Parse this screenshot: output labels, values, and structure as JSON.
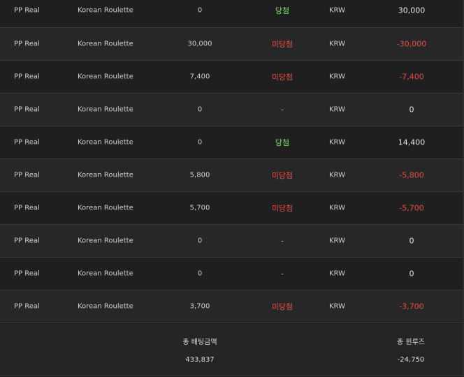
{
  "rows": [
    {
      "provider": "PP Real",
      "game": "Korean Roulette",
      "bet": "0",
      "result": "당첨",
      "result_type": "win",
      "currency": "KRW",
      "win": "30,000",
      "win_type": "pos"
    },
    {
      "provider": "PP Real",
      "game": "Korean Roulette",
      "bet": "30,000",
      "result": "미당첨",
      "result_type": "lose",
      "currency": "KRW",
      "win": "-30,000",
      "win_type": "neg"
    },
    {
      "provider": "PP Real",
      "game": "Korean Roulette",
      "bet": "7,400",
      "result": "미당첨",
      "result_type": "lose",
      "currency": "KRW",
      "win": "-7,400",
      "win_type": "neg"
    },
    {
      "provider": "PP Real",
      "game": "Korean Roulette",
      "bet": "0",
      "result": "-",
      "result_type": "none",
      "currency": "KRW",
      "win": "0",
      "win_type": "pos"
    },
    {
      "provider": "PP Real",
      "game": "Korean Roulette",
      "bet": "0",
      "result": "당첨",
      "result_type": "win",
      "currency": "KRW",
      "win": "14,400",
      "win_type": "pos"
    },
    {
      "provider": "PP Real",
      "game": "Korean Roulette",
      "bet": "5,800",
      "result": "미당첨",
      "result_type": "lose",
      "currency": "KRW",
      "win": "-5,800",
      "win_type": "neg"
    },
    {
      "provider": "PP Real",
      "game": "Korean Roulette",
      "bet": "5,700",
      "result": "미당첨",
      "result_type": "lose",
      "currency": "KRW",
      "win": "-5,700",
      "win_type": "neg"
    },
    {
      "provider": "PP Real",
      "game": "Korean Roulette",
      "bet": "0",
      "result": "-",
      "result_type": "none",
      "currency": "KRW",
      "win": "0",
      "win_type": "pos"
    },
    {
      "provider": "PP Real",
      "game": "Korean Roulette",
      "bet": "0",
      "result": "-",
      "result_type": "none",
      "currency": "KRW",
      "win": "0",
      "win_type": "pos"
    },
    {
      "provider": "PP Real",
      "game": "Korean Roulette",
      "bet": "3,700",
      "result": "미당첨",
      "result_type": "lose",
      "currency": "KRW",
      "win": "-3,700",
      "win_type": "neg"
    }
  ],
  "footer": {
    "total_bet_label": "총 배팅금액",
    "total_bet_value": "433,837",
    "total_winloss_label": "총 윈루즈",
    "total_winloss_value": "-24,750"
  },
  "colors": {
    "top_bar": "#1e5e3c",
    "result_win": "#7ee06a",
    "result_lose": "#e0504a",
    "row_odd": "#1f1f1f",
    "row_even": "#272727"
  }
}
